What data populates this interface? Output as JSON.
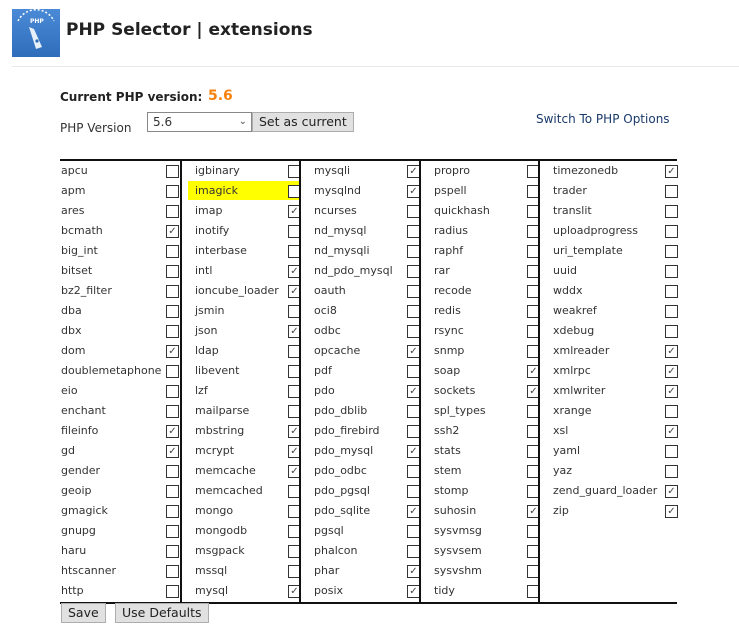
{
  "header": {
    "title": "PHP Selector | extensions",
    "logo_text": "PHP"
  },
  "current": {
    "label": "Current PHP version:",
    "value": "5.6",
    "value_color": "#f7820c"
  },
  "version": {
    "label": "PHP Version",
    "selected": "5.6",
    "set_button": "Set as current"
  },
  "switch_link": "Switch To PHP Options",
  "highlighted_extension": "imagick",
  "columns": [
    [
      [
        "apcu",
        false
      ],
      [
        "apm",
        false
      ],
      [
        "ares",
        false
      ],
      [
        "bcmath",
        true
      ],
      [
        "big_int",
        false
      ],
      [
        "bitset",
        false
      ],
      [
        "bz2_filter",
        false
      ],
      [
        "dba",
        false
      ],
      [
        "dbx",
        false
      ],
      [
        "dom",
        true
      ],
      [
        "doublemetaphone",
        false
      ],
      [
        "eio",
        false
      ],
      [
        "enchant",
        false
      ],
      [
        "fileinfo",
        true
      ],
      [
        "gd",
        true
      ],
      [
        "gender",
        false
      ],
      [
        "geoip",
        false
      ],
      [
        "gmagick",
        false
      ],
      [
        "gnupg",
        false
      ],
      [
        "haru",
        false
      ],
      [
        "htscanner",
        false
      ],
      [
        "http",
        false
      ]
    ],
    [
      [
        "igbinary",
        false
      ],
      [
        "imagick",
        false
      ],
      [
        "imap",
        true
      ],
      [
        "inotify",
        false
      ],
      [
        "interbase",
        false
      ],
      [
        "intl",
        true
      ],
      [
        "ioncube_loader",
        true
      ],
      [
        "jsmin",
        false
      ],
      [
        "json",
        true
      ],
      [
        "ldap",
        false
      ],
      [
        "libevent",
        false
      ],
      [
        "lzf",
        false
      ],
      [
        "mailparse",
        false
      ],
      [
        "mbstring",
        true
      ],
      [
        "mcrypt",
        true
      ],
      [
        "memcache",
        true
      ],
      [
        "memcached",
        false
      ],
      [
        "mongo",
        false
      ],
      [
        "mongodb",
        false
      ],
      [
        "msgpack",
        false
      ],
      [
        "mssql",
        false
      ],
      [
        "mysql",
        true
      ]
    ],
    [
      [
        "mysqli",
        true
      ],
      [
        "mysqlnd",
        true
      ],
      [
        "ncurses",
        false
      ],
      [
        "nd_mysql",
        false
      ],
      [
        "nd_mysqli",
        false
      ],
      [
        "nd_pdo_mysql",
        false
      ],
      [
        "oauth",
        false
      ],
      [
        "oci8",
        false
      ],
      [
        "odbc",
        false
      ],
      [
        "opcache",
        true
      ],
      [
        "pdf",
        false
      ],
      [
        "pdo",
        true
      ],
      [
        "pdo_dblib",
        false
      ],
      [
        "pdo_firebird",
        false
      ],
      [
        "pdo_mysql",
        true
      ],
      [
        "pdo_odbc",
        false
      ],
      [
        "pdo_pgsql",
        false
      ],
      [
        "pdo_sqlite",
        true
      ],
      [
        "pgsql",
        false
      ],
      [
        "phalcon",
        false
      ],
      [
        "phar",
        true
      ],
      [
        "posix",
        true
      ]
    ],
    [
      [
        "propro",
        false
      ],
      [
        "pspell",
        false
      ],
      [
        "quickhash",
        false
      ],
      [
        "radius",
        false
      ],
      [
        "raphf",
        false
      ],
      [
        "rar",
        false
      ],
      [
        "recode",
        false
      ],
      [
        "redis",
        false
      ],
      [
        "rsync",
        false
      ],
      [
        "snmp",
        false
      ],
      [
        "soap",
        true
      ],
      [
        "sockets",
        true
      ],
      [
        "spl_types",
        false
      ],
      [
        "ssh2",
        false
      ],
      [
        "stats",
        false
      ],
      [
        "stem",
        false
      ],
      [
        "stomp",
        false
      ],
      [
        "suhosin",
        true
      ],
      [
        "sysvmsg",
        false
      ],
      [
        "sysvsem",
        false
      ],
      [
        "sysvshm",
        false
      ],
      [
        "tidy",
        false
      ]
    ],
    [
      [
        "timezonedb",
        true
      ],
      [
        "trader",
        false
      ],
      [
        "translit",
        false
      ],
      [
        "uploadprogress",
        false
      ],
      [
        "uri_template",
        false
      ],
      [
        "uuid",
        false
      ],
      [
        "wddx",
        false
      ],
      [
        "weakref",
        false
      ],
      [
        "xdebug",
        false
      ],
      [
        "xmlreader",
        true
      ],
      [
        "xmlrpc",
        true
      ],
      [
        "xmlwriter",
        true
      ],
      [
        "xrange",
        false
      ],
      [
        "xsl",
        true
      ],
      [
        "yaml",
        false
      ],
      [
        "yaz",
        false
      ],
      [
        "zend_guard_loader",
        true
      ],
      [
        "zip",
        true
      ]
    ]
  ],
  "footer": {
    "save": "Save",
    "defaults": "Use Defaults"
  }
}
